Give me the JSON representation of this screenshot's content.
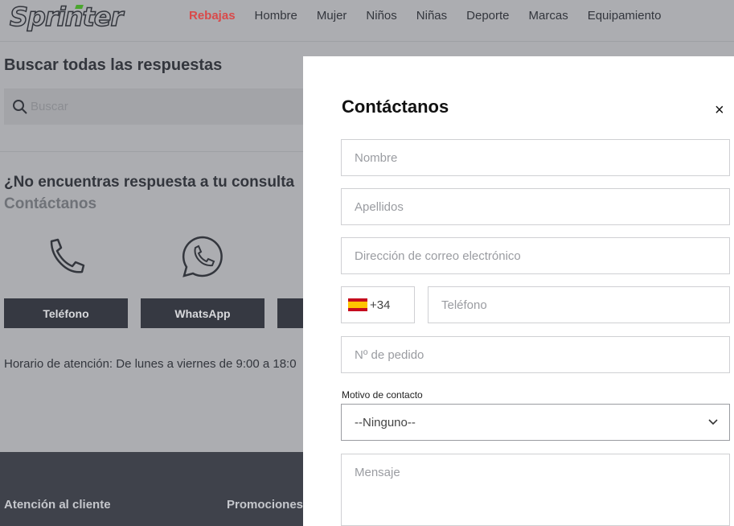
{
  "header": {
    "logo": "Sprinter",
    "nav": [
      "Rebajas",
      "Hombre",
      "Mujer",
      "Niños",
      "Niñas",
      "Deporte",
      "Marcas",
      "Equipamiento"
    ]
  },
  "page": {
    "title": "Buscar todas las respuestas",
    "search_placeholder": "Buscar",
    "question": "¿No encuentras respuesta a tu consulta",
    "contact_heading": "Contáctanos",
    "buttons": [
      "Teléfono",
      "WhatsApp"
    ],
    "hours": "Horario de atención: De lunes a viernes de 9:00 a 18:0"
  },
  "footer": {
    "columns": [
      "Atención al cliente",
      "Promociones"
    ]
  },
  "modal": {
    "title": "Contáctanos",
    "close": "×",
    "nombre": "Nombre",
    "apellidos": "Apellidos",
    "email": "Dirección de correo electrónico",
    "prefix": "+34",
    "telefono": "Teléfono",
    "pedido": "Nº de pedido",
    "motivo_label": "Motivo de contacto",
    "motivo_value": "--Ninguno--",
    "mensaje": "Mensaje"
  },
  "colors": {
    "accent": "#d94a4a",
    "button": "#363942",
    "footer": "#3f424b"
  }
}
